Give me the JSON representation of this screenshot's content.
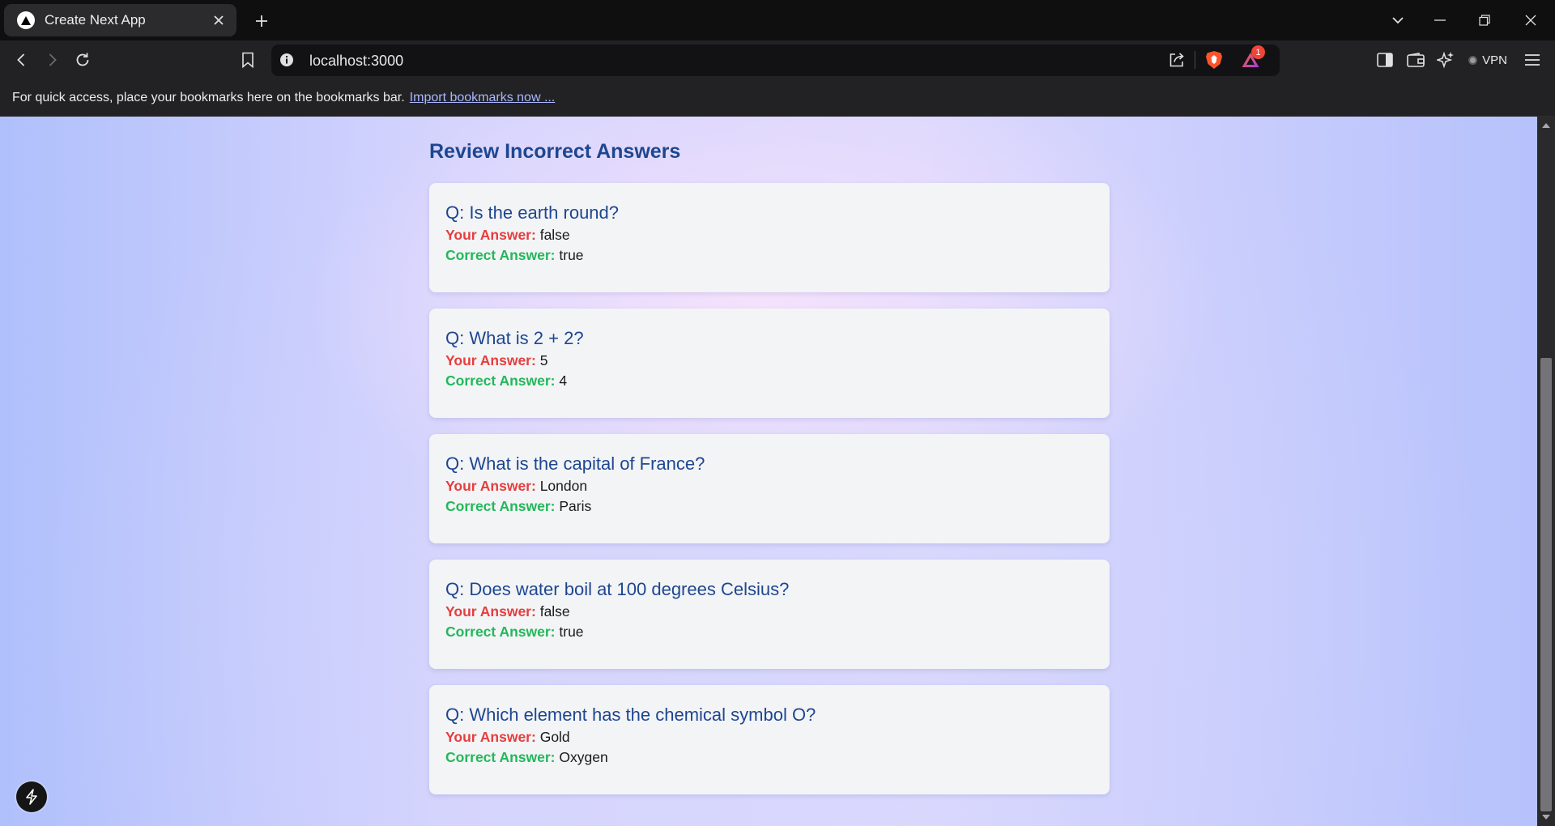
{
  "browser": {
    "tab": {
      "title": "Create Next App"
    },
    "address_bar": {
      "url": "localhost:3000"
    },
    "notification_count": "1",
    "vpn_label": "VPN"
  },
  "bookmarks_bar": {
    "message": "For quick access, place your bookmarks here on the bookmarks bar.",
    "import_link": "Import bookmarks now ..."
  },
  "review": {
    "title": "Review Incorrect Answers",
    "your_answer_label": "Your Answer:",
    "correct_answer_label": "Correct Answer:",
    "items": [
      {
        "question": "Q: Is the earth round?",
        "your_answer": "false",
        "correct_answer": "true"
      },
      {
        "question": "Q: What is 2 + 2?",
        "your_answer": "5",
        "correct_answer": "4"
      },
      {
        "question": "Q: What is the capital of France?",
        "your_answer": "London",
        "correct_answer": "Paris"
      },
      {
        "question": "Q: Does water boil at 100 degrees Celsius?",
        "your_answer": "false",
        "correct_answer": "true"
      },
      {
        "question": "Q: Which element has the chemical symbol O?",
        "your_answer": "Gold",
        "correct_answer": "Oxygen"
      }
    ]
  },
  "colors": {
    "heading": "#1e4690",
    "wrong_label": "#e53e3e",
    "correct_label": "#22b85a",
    "card_background": "#f3f4f6"
  },
  "icons": {
    "tab": [
      "nextjs-triangle-icon",
      "close-icon",
      "plus-icon"
    ],
    "window": [
      "chevron-down-icon",
      "minimize-icon",
      "restore-icon",
      "close-window-icon"
    ],
    "toolbar": [
      "back-icon",
      "forward-icon",
      "reload-icon",
      "bookmark-icon",
      "site-info-icon",
      "share-icon",
      "brave-shield-icon",
      "brave-rewards-icon",
      "sidebar-icon",
      "wallet-icon",
      "leo-ai-icon",
      "menu-icon"
    ],
    "page": [
      "nextjs-dev-tools-icon"
    ]
  }
}
